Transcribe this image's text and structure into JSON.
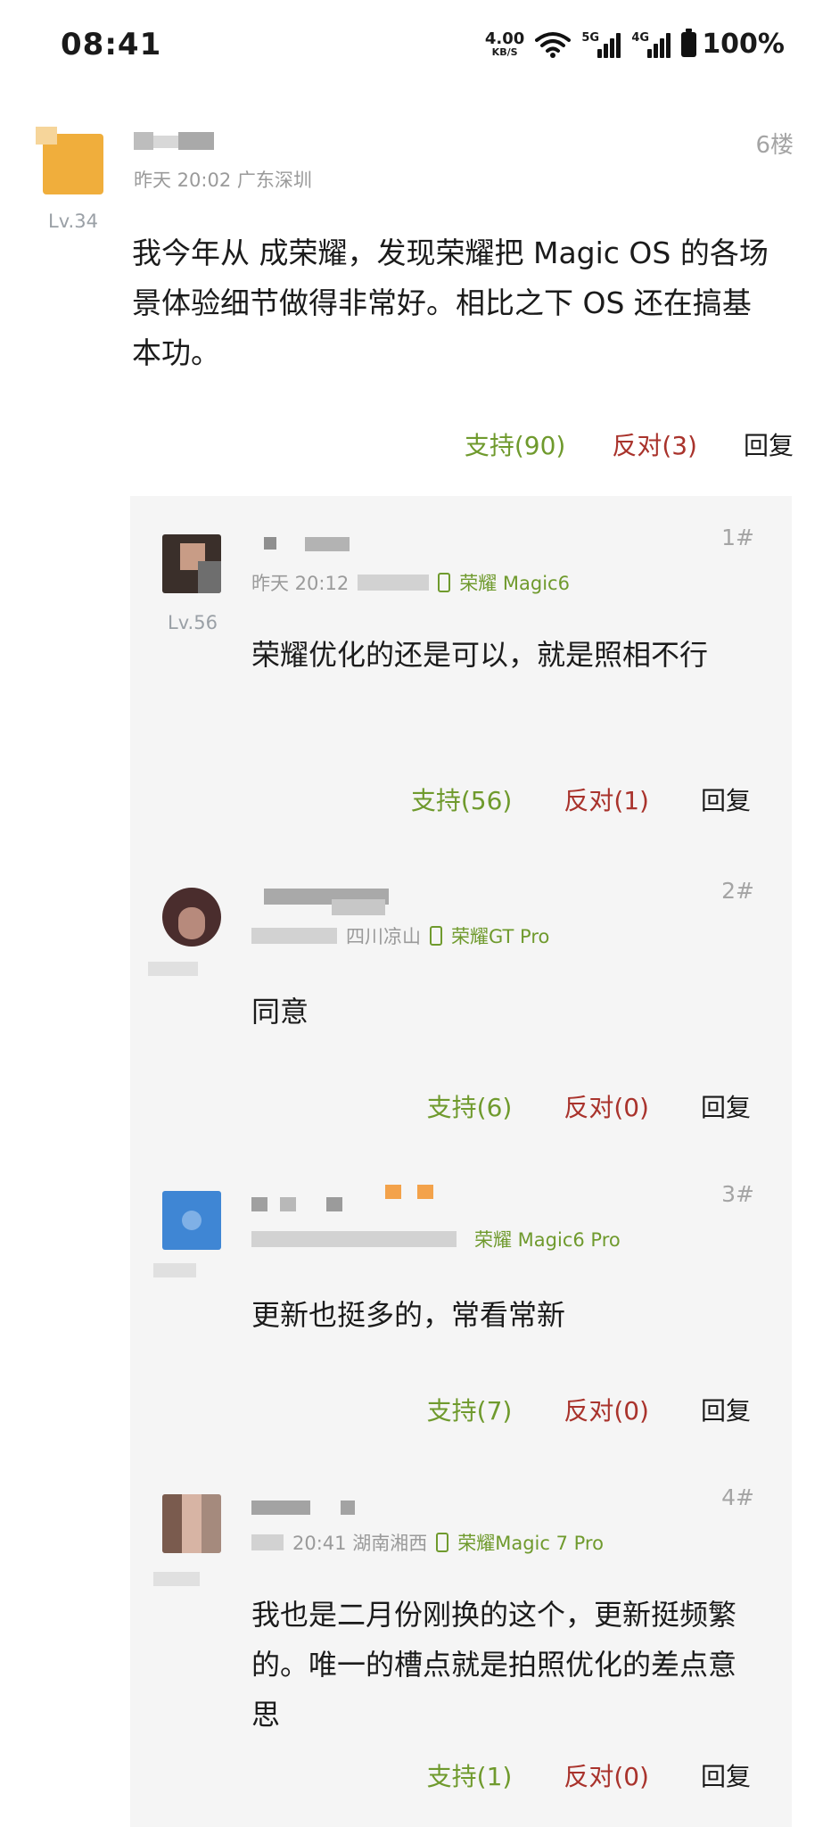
{
  "status_bar": {
    "time": "08:41",
    "net_speed_value": "4.00",
    "net_speed_unit": "KB/S",
    "signal_1": "5G",
    "signal_2": "4G",
    "battery": "100%"
  },
  "main_post": {
    "meta": "昨天 20:02  广东深圳",
    "level": "Lv.34",
    "floor": "6楼",
    "content": "我今年从        成荣耀，发现荣耀把 Magic OS 的各场景体验细节做得非常好。相比之下       OS 还在搞基本功。",
    "actions": {
      "support": "支持(90)",
      "oppose": "反对(3)",
      "reply": "回复"
    }
  },
  "replies": [
    {
      "floor": "1#",
      "level": "Lv.56",
      "meta": "昨天 20:12",
      "device": "荣耀 Magic6",
      "content": "荣耀优化的还是可以，就是照相不行",
      "actions": {
        "support": "支持(56)",
        "oppose": "反对(1)",
        "reply": "回复"
      }
    },
    {
      "floor": "2#",
      "meta": "四川凉山",
      "device": "荣耀GT Pro",
      "content": "同意",
      "actions": {
        "support": "支持(6)",
        "oppose": "反对(0)",
        "reply": "回复"
      }
    },
    {
      "floor": "3#",
      "meta": "",
      "device": "荣耀 Magic6 Pro",
      "content": "更新也挺多的，常看常新",
      "actions": {
        "support": "支持(7)",
        "oppose": "反对(0)",
        "reply": "回复"
      }
    },
    {
      "floor": "4#",
      "meta": "20:41  湖南湘西",
      "device": "荣耀Magic 7 Pro",
      "content": "我也是二月份刚换的这个，更新挺频繁的。唯一的槽点就是拍照优化的差点意思",
      "actions": {
        "support": "支持(1)",
        "oppose": "反对(0)",
        "reply": "回复"
      }
    }
  ],
  "colors": {
    "support": "#6f9a2d",
    "oppose": "#a9332c",
    "panel_bg": "#f5f5f5"
  }
}
